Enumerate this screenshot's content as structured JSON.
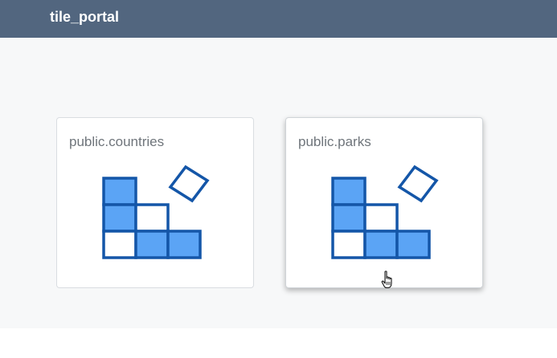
{
  "header": {
    "title": "tile_portal"
  },
  "colors": {
    "header_bg": "#52667f",
    "content_bg": "#f7f8f9",
    "icon_stroke": "#1456a8",
    "icon_fill": "#5ba4f5"
  },
  "cards": [
    {
      "label": "public.countries",
      "icon": "tile-grid-icon"
    },
    {
      "label": "public.parks",
      "icon": "tile-grid-icon"
    }
  ],
  "cursor": {
    "icon": "hand-pointer-icon"
  }
}
